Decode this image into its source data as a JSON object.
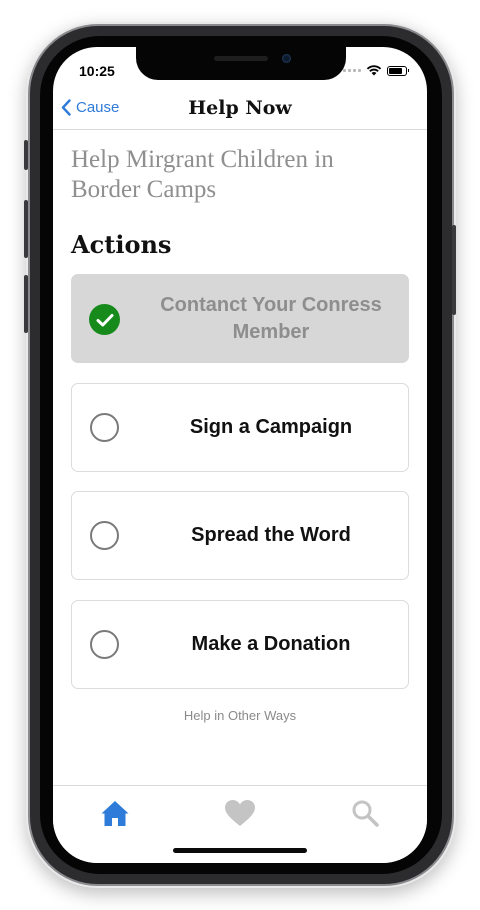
{
  "status_bar": {
    "time": "10:25"
  },
  "nav": {
    "back_label": "Cause",
    "title": "Help Now"
  },
  "cause": {
    "title": "Help Mirgrant Children in Border Camps"
  },
  "actions": {
    "heading": "Actions",
    "items": [
      {
        "label": "Contanct Your Conress Member",
        "completed": true
      },
      {
        "label": "Sign a Campaign",
        "completed": false
      },
      {
        "label": "Spread the Word",
        "completed": false
      },
      {
        "label": "Make a Donation",
        "completed": false
      }
    ]
  },
  "other_ways_link": "Help in Other Ways",
  "tabbar": {
    "items": [
      {
        "icon": "home-icon",
        "selected": true
      },
      {
        "icon": "heart-icon",
        "selected": false
      },
      {
        "icon": "search-icon",
        "selected": false
      }
    ]
  },
  "colors": {
    "accent": "#2f7bd9",
    "completed_green": "#178a1c",
    "completed_bg": "#d7d7d7",
    "inactive_icon": "#c4c4c4"
  }
}
